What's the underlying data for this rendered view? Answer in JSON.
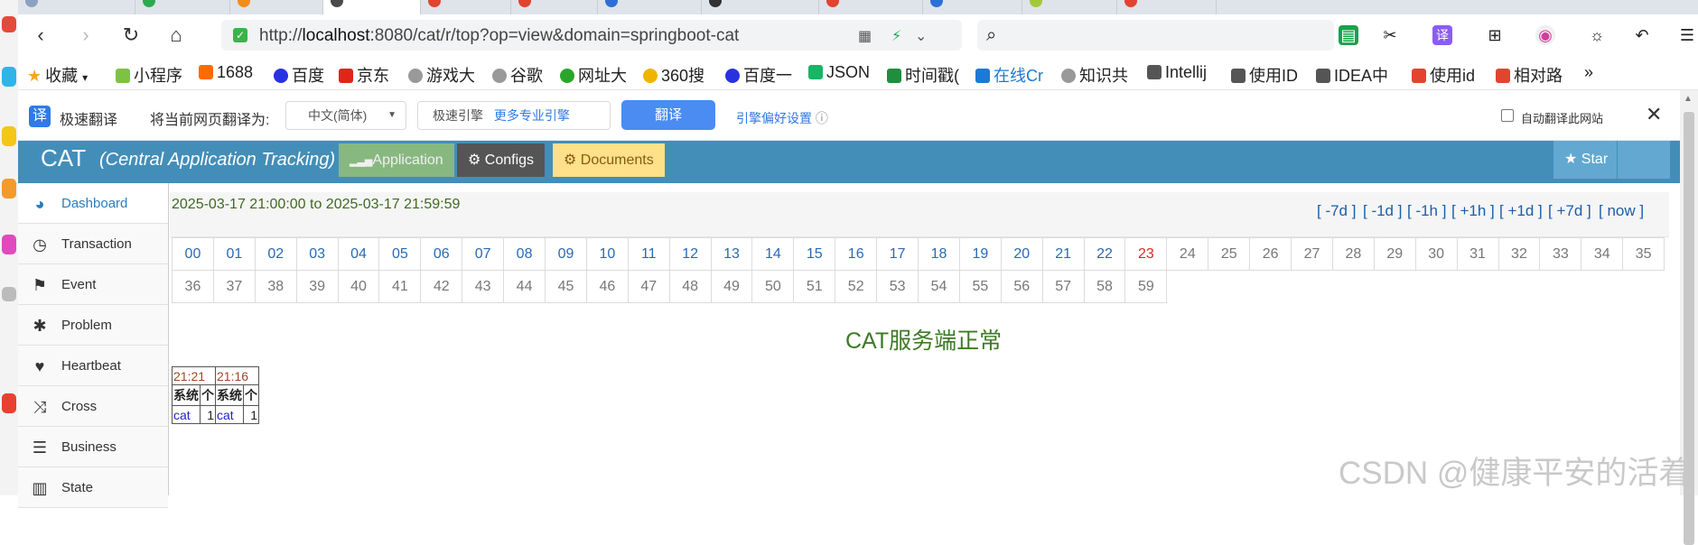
{
  "browser": {
    "url_prefix": "http://",
    "url_host": "localhost",
    "url_rest": ":8080/cat/r/top?op=view&domain=springboot-cat",
    "nav": {
      "back": "‹",
      "forward": "›",
      "reload": "↻",
      "home": "⌂"
    }
  },
  "bookmarks": [
    {
      "label": "收藏",
      "color": "#f5a623"
    },
    {
      "label": "小程序",
      "color": "#7dc242"
    },
    {
      "label": "1688",
      "color": "#ff6a00"
    },
    {
      "label": "百度",
      "color": "#2932e1"
    },
    {
      "label": "京东",
      "color": "#e1251b"
    },
    {
      "label": "游戏大",
      "color": "#999999"
    },
    {
      "label": "谷歌",
      "color": "#999999"
    },
    {
      "label": "网址大",
      "color": "#2aa52a"
    },
    {
      "label": "360搜",
      "color": "#f0b400"
    },
    {
      "label": "百度一",
      "color": "#2932e1"
    },
    {
      "label": "JSON",
      "color": "#18b566"
    },
    {
      "label": "时间戳(",
      "color": "#1f8f3e"
    },
    {
      "label": "在线Cr",
      "color": "#1a7ad8"
    },
    {
      "label": "知识共",
      "color": "#999999"
    },
    {
      "label": "Intellij",
      "color": "#555555"
    },
    {
      "label": "使用ID",
      "color": "#555555"
    },
    {
      "label": "IDEA中",
      "color": "#555555"
    },
    {
      "label": "使用id",
      "color": "#e2452f"
    },
    {
      "label": "相对路",
      "color": "#e2452f"
    },
    {
      "label": "»",
      "color": ""
    }
  ],
  "translate_bar": {
    "logo": "译",
    "title": "极速翻译",
    "prompt": "将当前网页翻译为:",
    "language": "中文(简体)",
    "engine": "极速引擎",
    "more_engines": "更多专业引擎",
    "button": "翻译",
    "prefs": "引擎偏好设置",
    "auto_label": "自动翻译此网站",
    "close": "✕"
  },
  "cat": {
    "logo": "CAT",
    "subtitle": "(Central Application Tracking)",
    "tabs": [
      "Application",
      "Configs",
      "Documents"
    ],
    "star": "Star",
    "colors": {
      "header": "#438eb9",
      "application": "#87b87f",
      "configs": "#555555",
      "documents": "#fee188"
    }
  },
  "sidebar": [
    {
      "label": "Dashboard",
      "icon": "dashboard-icon",
      "glyph": "◕"
    },
    {
      "label": "Transaction",
      "icon": "clock-icon",
      "glyph": "◷"
    },
    {
      "label": "Event",
      "icon": "flag-icon",
      "glyph": "⚑"
    },
    {
      "label": "Problem",
      "icon": "bug-icon",
      "glyph": "✱"
    },
    {
      "label": "Heartbeat",
      "icon": "heart-icon",
      "glyph": "♥"
    },
    {
      "label": "Cross",
      "icon": "shuffle-icon",
      "glyph": "⤨"
    },
    {
      "label": "Business",
      "icon": "list-icon",
      "glyph": "☰"
    },
    {
      "label": "State",
      "icon": "bar-chart-icon",
      "glyph": "▥"
    }
  ],
  "main": {
    "range": "2025-03-17 21:00:00 to 2025-03-17 21:59:59",
    "nav_links": [
      "[ -7d ]",
      "[ -1d ]",
      "[ -1h ]",
      "[ +1h ]",
      "[ +1d ]",
      "[ +7d ]",
      "[ now ]"
    ],
    "minutes_row1": [
      "00",
      "01",
      "02",
      "03",
      "04",
      "05",
      "06",
      "07",
      "08",
      "09",
      "10",
      "11",
      "12",
      "13",
      "14",
      "15",
      "16",
      "17",
      "18",
      "19",
      "20",
      "21",
      "22",
      "23",
      "24",
      "25",
      "26",
      "27",
      "28",
      "29",
      "30",
      "31",
      "32",
      "33",
      "34",
      "35"
    ],
    "minutes_row2": [
      "36",
      "37",
      "38",
      "39",
      "40",
      "41",
      "42",
      "43",
      "44",
      "45",
      "46",
      "47",
      "48",
      "49",
      "50",
      "51",
      "52",
      "53",
      "54",
      "55",
      "56",
      "57",
      "58",
      "59"
    ],
    "current_minute": "23",
    "status": "CAT服务端正常",
    "mini_table": {
      "times": [
        "21:21",
        "21:16"
      ],
      "headers": [
        "系统",
        "个"
      ],
      "rows": [
        [
          "cat",
          "1"
        ],
        [
          "cat",
          "1"
        ]
      ]
    }
  },
  "watermark": "CSDN @健康平安的活着"
}
